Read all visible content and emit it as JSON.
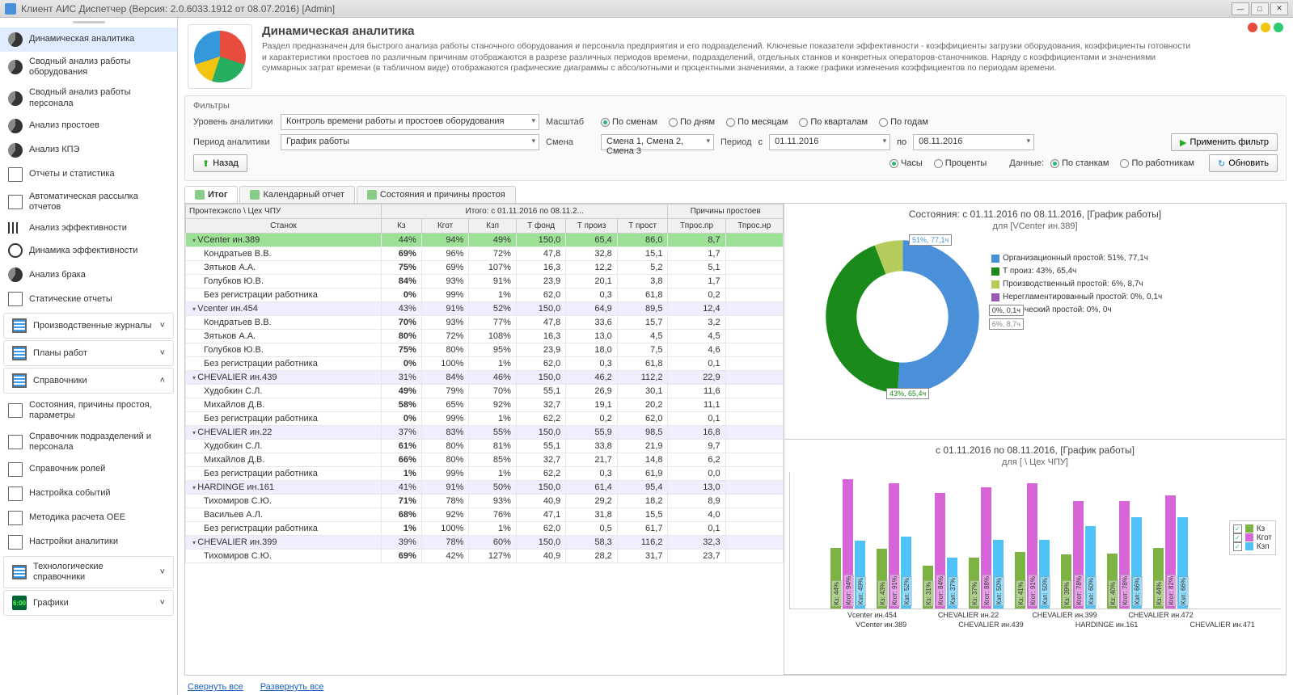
{
  "window": {
    "title": "Клиент АИС Диспетчер (Версия: 2.0.6033.1912 от 08.07.2016) [Admin]"
  },
  "sidebar": {
    "items": [
      {
        "label": "Динамическая аналитика",
        "icon": "pie",
        "selected": true
      },
      {
        "label": "Сводный анализ работы оборудования",
        "icon": "pie"
      },
      {
        "label": "Сводный анализ работы персонала",
        "icon": "pie"
      },
      {
        "label": "Анализ простоев",
        "icon": "pie"
      },
      {
        "label": "Анализ КПЭ",
        "icon": "pie"
      },
      {
        "label": "Отчеты и статистика",
        "icon": "doc"
      },
      {
        "label": "Автоматическая рассылка отчетов",
        "icon": "doc"
      },
      {
        "label": "Анализ эффективности",
        "icon": "bars"
      },
      {
        "label": "Динамика эффективности",
        "icon": "pie-out"
      },
      {
        "label": "Анализ брака",
        "icon": "pie"
      },
      {
        "label": "Статические отчеты",
        "icon": "doc"
      }
    ],
    "groups": [
      {
        "label": "Производственные журналы",
        "icon": "grid",
        "expanded": false
      },
      {
        "label": "Планы работ",
        "icon": "grid",
        "expanded": false
      },
      {
        "label": "Справочники",
        "icon": "grid",
        "expanded": true,
        "children": [
          {
            "label": "Состояния, причины простоя, параметры"
          },
          {
            "label": "Справочник подразделений и персонала"
          },
          {
            "label": "Справочник ролей"
          },
          {
            "label": "Настройка событий"
          },
          {
            "label": "Методика расчета OEE"
          },
          {
            "label": "Настройки аналитики"
          }
        ]
      },
      {
        "label": "Технологические справочники",
        "icon": "grid",
        "expanded": false
      },
      {
        "label": "Графики",
        "icon": "clock",
        "expanded": false
      }
    ]
  },
  "header": {
    "title": "Динамическая аналитика",
    "desc": "Раздел предназначен для быстрого анализа работы станочного оборудования и персонала предприятия и его подразделений. Ключевые показатели эффективности - коэффициенты загрузки оборудования, коэффициенты готовности и характеристики простоев по различным причинам отображаются в разрезе различных периодов времени, подразделений, отдельных станков и конкретных операторов-станочников. Наряду с коэффициентами и значениями суммарных затрат времени (в табличном виде) отображаются графические диаграммы с абсолютными и процентными значениями, а также графики изменения коэффициентов по периодам времени."
  },
  "filters": {
    "title": "Фильтры",
    "level_label": "Уровень аналитики",
    "level_value": "Контроль времени работы и простоев оборудования",
    "scale_label": "Масштаб",
    "scale_opts": [
      "По сменам",
      "По дням",
      "По месяцам",
      "По кварталам",
      "По годам"
    ],
    "scale_sel": 0,
    "period_label": "Период аналитики",
    "period_value": "График работы",
    "shift_label": "Смена",
    "shift_value": "Смена 1, Смена 2, Смена 3",
    "range_label": "Период",
    "from_label": "с",
    "from_value": "01.11.2016",
    "to_label": "по",
    "to_value": "08.11.2016",
    "apply_btn": "Применить фильтр",
    "back_btn": "Назад",
    "unit_opts": [
      "Часы",
      "Проценты"
    ],
    "unit_sel": 0,
    "data_label": "Данные:",
    "data_opts": [
      "По станкам",
      "По работникам"
    ],
    "data_sel": 0,
    "refresh_btn": "Обновить"
  },
  "tabs": [
    {
      "label": "Итог",
      "active": true
    },
    {
      "label": "Календарный отчет",
      "active": false
    },
    {
      "label": "Состояния и причины простоя",
      "active": false
    }
  ],
  "grid": {
    "band_hierarchy": "Пронтехэкспо \\ Цех ЧПУ",
    "band_totals": "Итого: с 01.11.2016 по 08.11.2...",
    "band_reasons": "Причины простоев",
    "col_name": "Станок",
    "cols": [
      "Кз",
      "Кгот",
      "Кзп",
      "Т фонд",
      "Т произ",
      "Т прост",
      "Тпрос.пр",
      "Тпрос.нр"
    ],
    "rows": [
      {
        "t": "m",
        "hl": true,
        "name": "VCenter ин.389",
        "v": [
          "44%",
          "94%",
          "49%",
          "150,0",
          "65,4",
          "86,0",
          "8,7",
          ""
        ]
      },
      {
        "t": "p",
        "name": "Кондратьев В.В.",
        "v": [
          "69%",
          "96%",
          "72%",
          "47,8",
          "32,8",
          "15,1",
          "1,7",
          ""
        ]
      },
      {
        "t": "p",
        "name": "Зятьков А.А.",
        "v": [
          "75%",
          "69%",
          "107%",
          "16,3",
          "12,2",
          "5,2",
          "5,1",
          ""
        ]
      },
      {
        "t": "p",
        "name": "Голубков Ю.В.",
        "v": [
          "84%",
          "93%",
          "91%",
          "23,9",
          "20,1",
          "3,8",
          "1,7",
          ""
        ]
      },
      {
        "t": "p",
        "name": "Без регистрации работника",
        "v": [
          "0%",
          "99%",
          "1%",
          "62,0",
          "0,3",
          "61,8",
          "0,2",
          ""
        ]
      },
      {
        "t": "m",
        "name": "Vcenter ин.454",
        "v": [
          "43%",
          "91%",
          "52%",
          "150,0",
          "64,9",
          "89,5",
          "12,4",
          ""
        ]
      },
      {
        "t": "p",
        "name": "Кондратьев В.В.",
        "v": [
          "70%",
          "93%",
          "77%",
          "47,8",
          "33,6",
          "15,7",
          "3,2",
          ""
        ]
      },
      {
        "t": "p",
        "name": "Зятьков А.А.",
        "v": [
          "80%",
          "72%",
          "108%",
          "16,3",
          "13,0",
          "4,5",
          "4,5",
          ""
        ]
      },
      {
        "t": "p",
        "name": "Голубков Ю.В.",
        "v": [
          "75%",
          "80%",
          "95%",
          "23,9",
          "18,0",
          "7,5",
          "4,6",
          ""
        ]
      },
      {
        "t": "p",
        "name": "Без регистрации работника",
        "v": [
          "0%",
          "100%",
          "1%",
          "62,0",
          "0,3",
          "61,8",
          "0,1",
          ""
        ]
      },
      {
        "t": "m",
        "name": "CHEVALIER ин.439",
        "v": [
          "31%",
          "84%",
          "46%",
          "150,0",
          "46,2",
          "112,2",
          "22,9",
          ""
        ]
      },
      {
        "t": "p",
        "name": "Худобкин С.Л.",
        "v": [
          "49%",
          "79%",
          "70%",
          "55,1",
          "26,9",
          "30,1",
          "11,6",
          ""
        ]
      },
      {
        "t": "p",
        "name": "Михайлов Д.В.",
        "v": [
          "58%",
          "65%",
          "92%",
          "32,7",
          "19,1",
          "20,2",
          "11,1",
          ""
        ]
      },
      {
        "t": "p",
        "name": "Без регистрации работника",
        "v": [
          "0%",
          "99%",
          "1%",
          "62,2",
          "0,2",
          "62,0",
          "0,1",
          ""
        ]
      },
      {
        "t": "m",
        "name": "CHEVALIER ин.22",
        "v": [
          "37%",
          "83%",
          "55%",
          "150,0",
          "55,9",
          "98,5",
          "16,8",
          ""
        ]
      },
      {
        "t": "p",
        "name": "Худобкин С.Л.",
        "v": [
          "61%",
          "80%",
          "81%",
          "55,1",
          "33,8",
          "21,9",
          "9,7",
          ""
        ]
      },
      {
        "t": "p",
        "name": "Михайлов Д.В.",
        "v": [
          "66%",
          "80%",
          "85%",
          "32,7",
          "21,7",
          "14,8",
          "6,2",
          ""
        ]
      },
      {
        "t": "p",
        "name": "Без регистрации работника",
        "v": [
          "1%",
          "99%",
          "1%",
          "62,2",
          "0,3",
          "61,9",
          "0,0",
          ""
        ]
      },
      {
        "t": "m",
        "name": "HARDINGE ин.161",
        "v": [
          "41%",
          "91%",
          "50%",
          "150,0",
          "61,4",
          "95,4",
          "13,0",
          ""
        ]
      },
      {
        "t": "p",
        "name": "Тихомиров С.Ю.",
        "v": [
          "71%",
          "78%",
          "93%",
          "40,9",
          "29,2",
          "18,2",
          "8,9",
          ""
        ]
      },
      {
        "t": "p",
        "name": "Васильев А.Л.",
        "v": [
          "68%",
          "92%",
          "76%",
          "47,1",
          "31,8",
          "15,5",
          "4,0",
          ""
        ]
      },
      {
        "t": "p",
        "name": "Без регистрации работника",
        "v": [
          "1%",
          "100%",
          "1%",
          "62,0",
          "0,5",
          "61,7",
          "0,1",
          ""
        ]
      },
      {
        "t": "m",
        "name": "CHEVALIER ин.399",
        "v": [
          "39%",
          "78%",
          "60%",
          "150,0",
          "58,3",
          "116,2",
          "32,3",
          ""
        ]
      },
      {
        "t": "p",
        "name": "Тихомиров С.Ю.",
        "v": [
          "69%",
          "42%",
          "127%",
          "40,9",
          "28,2",
          "31,7",
          "23,7",
          ""
        ]
      }
    ]
  },
  "footer": {
    "collapse": "Свернуть все",
    "expand": "Развернуть все"
  },
  "chart_data": [
    {
      "type": "pie",
      "title": "Состояния: с 01.11.2016 по 08.11.2016, [График работы]",
      "subtitle": "для [VCenter ин.389]",
      "series": [
        {
          "name": "Организационный простой",
          "pct": 51,
          "hours": "77,1ч",
          "color": "#4a90d9"
        },
        {
          "name": "Т произ",
          "pct": 43,
          "hours": "65,4ч",
          "color": "#1a8a1a"
        },
        {
          "name": "Производственный простой",
          "pct": 6,
          "hours": "8,7ч",
          "color": "#b5cc5c"
        },
        {
          "name": "Нерегламентированный простой",
          "pct": 0,
          "hours": "0,1ч",
          "color": "#9b59b6"
        },
        {
          "name": "Технический простой",
          "pct": 0,
          "hours": "0ч",
          "color": "#5bc0de"
        }
      ],
      "callouts": [
        {
          "text": "51%, 77,1ч"
        },
        {
          "text": "0%, 0,1ч"
        },
        {
          "text": "6%, 8,7ч"
        },
        {
          "text": "43%, 65,4ч"
        }
      ]
    },
    {
      "type": "bar",
      "title": "с 01.11.2016 по 08.11.2016, [График работы]",
      "subtitle": "для [                         \\ Цех ЧПУ]",
      "ylabel": "%",
      "ylim": [
        0,
        100
      ],
      "yticks": [
        "0,00%",
        "20,00%",
        "40,00%",
        "60,00%",
        "80,00%"
      ],
      "categories": [
        "VCenter ин.389",
        "Vcenter ин.454",
        "CHEVALIER ин.439",
        "CHEVALIER ин.22",
        "HARDINGE ин.161",
        "CHEVALIER ин.399",
        "CHEVALIER ин.471",
        "CHEVALIER ин.472"
      ],
      "series": [
        {
          "name": "Кз",
          "color": "#7cb342",
          "values": [
            44,
            43,
            31,
            37,
            41,
            39,
            40,
            44
          ]
        },
        {
          "name": "Кгот",
          "color": "#d765d7",
          "values": [
            94,
            91,
            84,
            88,
            91,
            78,
            78,
            82
          ]
        },
        {
          "name": "Кзп",
          "color": "#4fc3f7",
          "values": [
            49,
            52,
            37,
            50,
            50,
            60,
            66,
            66
          ]
        }
      ],
      "legend": [
        "Кз",
        "Кгот",
        "Кзп"
      ]
    }
  ]
}
